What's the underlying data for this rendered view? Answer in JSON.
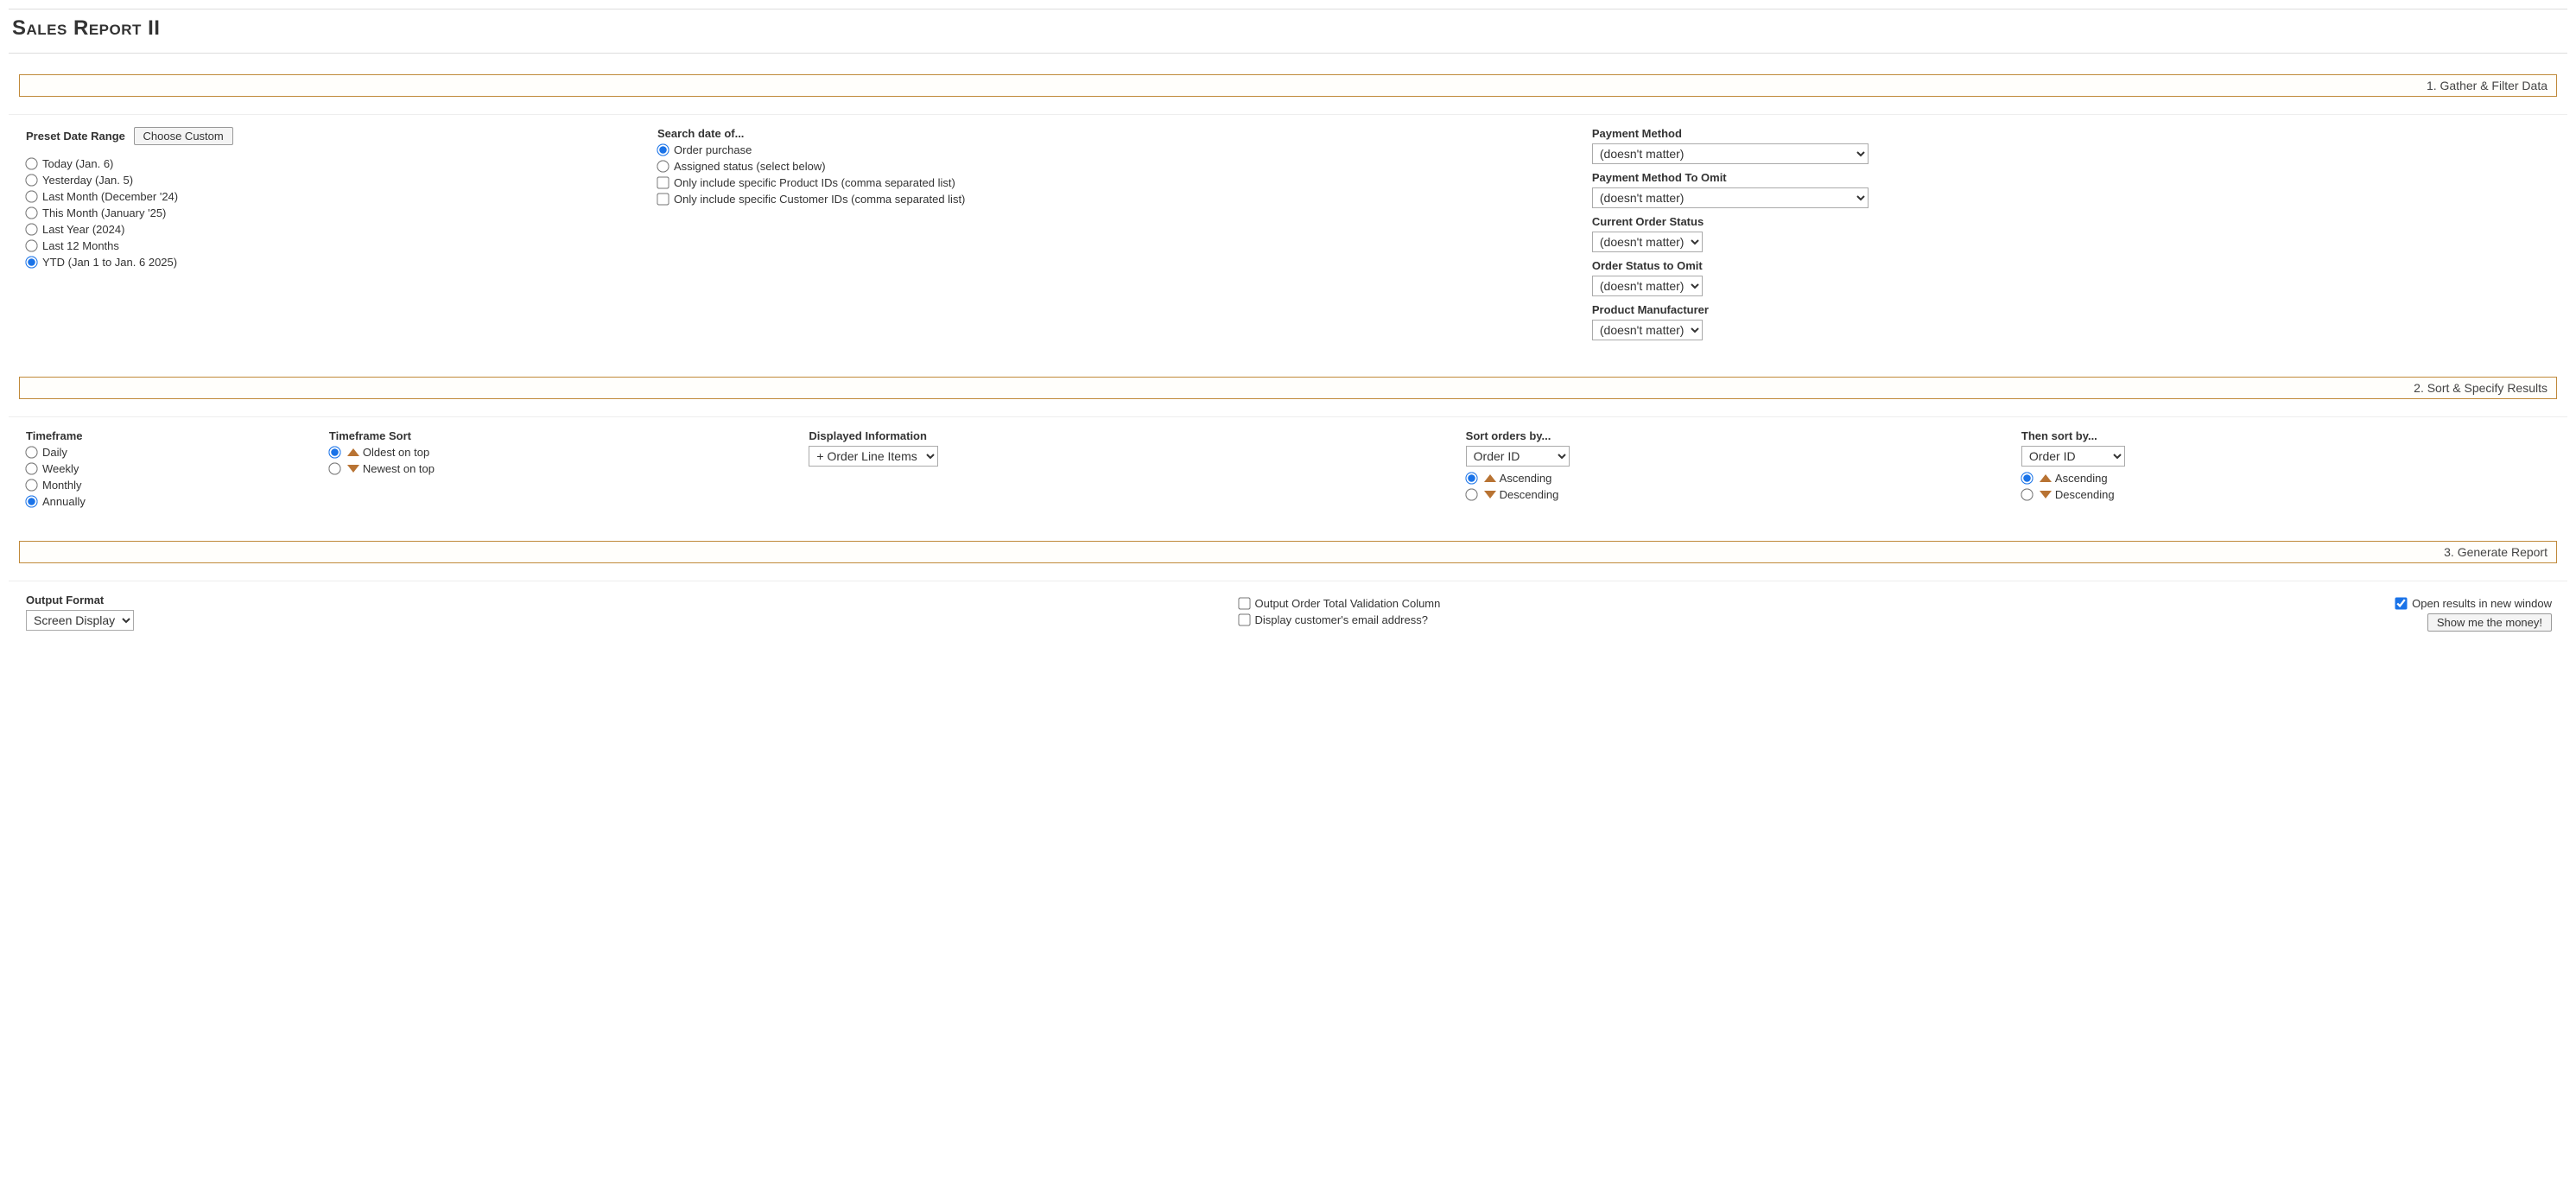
{
  "page": {
    "title": "Sales Report II"
  },
  "steps": {
    "s1": "1. Gather & Filter Data",
    "s2": "2. Sort & Specify Results",
    "s3": "3. Generate Report"
  },
  "preset": {
    "heading": "Preset Date Range",
    "choose_custom": "Choose Custom",
    "options": {
      "today": "Today (Jan. 6)",
      "yesterday": "Yesterday (Jan. 5)",
      "last_month": "Last Month (December '24)",
      "this_month": "This Month (January '25)",
      "last_year": "Last Year (2024)",
      "last_12": "Last 12 Months",
      "ytd": "YTD (Jan 1 to Jan. 6 2025)"
    },
    "selected": "ytd"
  },
  "search_date": {
    "heading": "Search date of...",
    "order_purchase": "Order purchase",
    "assigned_status": "Assigned status (select below)",
    "only_product": "Only include specific Product IDs (comma separated list)",
    "only_customer": "Only include specific Customer IDs (comma separated list)"
  },
  "filters": {
    "payment_method": {
      "label": "Payment Method",
      "value": "(doesn't matter)"
    },
    "payment_method_omit": {
      "label": "Payment Method To Omit",
      "value": "(doesn't matter)"
    },
    "current_order_status": {
      "label": "Current Order Status",
      "value": "(doesn't matter)"
    },
    "order_status_omit": {
      "label": "Order Status to Omit",
      "value": "(doesn't matter)"
    },
    "product_manufacturer": {
      "label": "Product Manufacturer",
      "value": "(doesn't matter)"
    }
  },
  "timeframe": {
    "heading": "Timeframe",
    "daily": "Daily",
    "weekly": "Weekly",
    "monthly": "Monthly",
    "annually": "Annually"
  },
  "timeframe_sort": {
    "heading": "Timeframe Sort",
    "oldest": "Oldest on top",
    "newest": "Newest on top"
  },
  "displayed_info": {
    "heading": "Displayed Information",
    "value": "+ Order Line Items"
  },
  "sort1": {
    "heading": "Sort orders by...",
    "value": "Order ID",
    "asc": "Ascending",
    "desc": "Descending"
  },
  "sort2": {
    "heading": "Then sort by...",
    "value": "Order ID",
    "asc": "Ascending",
    "desc": "Descending"
  },
  "output": {
    "heading": "Output Format",
    "value": "Screen Display",
    "validation_col": "Output Order Total Validation Column",
    "display_email": "Display customer's email address?",
    "new_window": "Open results in new window",
    "submit": "Show me the money!"
  }
}
